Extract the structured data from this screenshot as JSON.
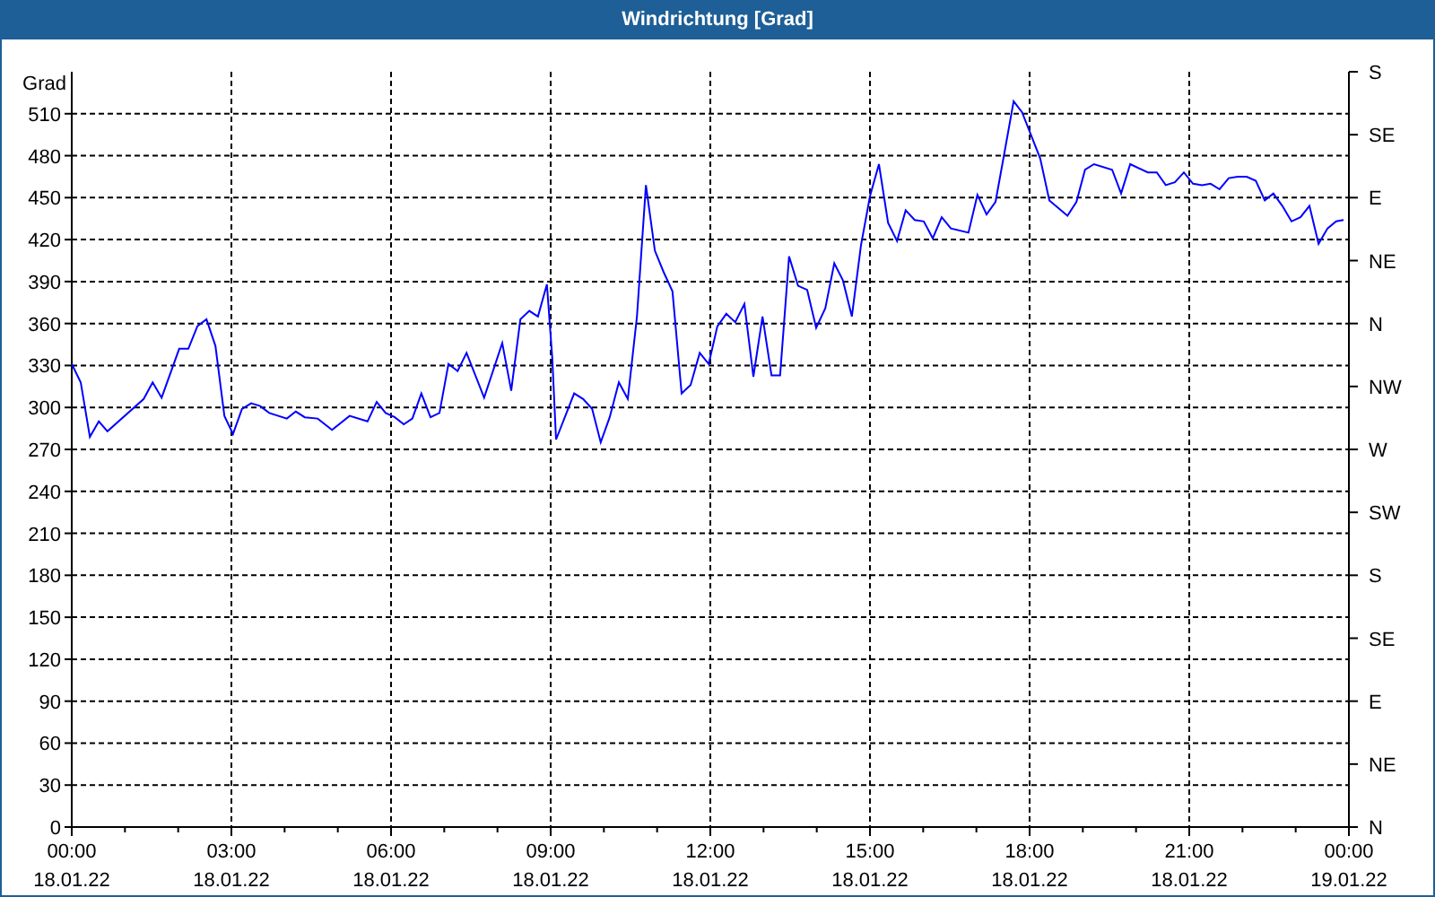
{
  "window": {
    "title": "Windrichtung [Grad]"
  },
  "chart": {
    "date_labels": [
      "18.01.22",
      "18.01.22",
      "18.01.22",
      "18.01.22",
      "18.01.22",
      "18.01.22",
      "18.01.22",
      "18.01.22",
      "19.01.22"
    ],
    "compass_labels": [
      "S",
      "SE",
      "E",
      "NE",
      "N",
      "NW",
      "W",
      "SW",
      "S",
      "SE",
      "E",
      "NE",
      "N"
    ],
    "chart_data": {
      "type": "line",
      "ylabel": "Grad",
      "xlim": [
        0,
        24
      ],
      "ylim": [
        0,
        540
      ],
      "grid": true,
      "yticks": [
        0,
        30,
        60,
        90,
        120,
        150,
        180,
        210,
        240,
        270,
        300,
        330,
        360,
        390,
        420,
        450,
        480,
        510
      ],
      "xticks": [
        {
          "value": 0,
          "label": "00:00"
        },
        {
          "value": 3,
          "label": "03:00"
        },
        {
          "value": 6,
          "label": "06:00"
        },
        {
          "value": 9,
          "label": "09:00"
        },
        {
          "value": 12,
          "label": "12:00"
        },
        {
          "value": 15,
          "label": "15:00"
        },
        {
          "value": 18,
          "label": "18:00"
        },
        {
          "value": 21,
          "label": "21:00"
        },
        {
          "value": 24,
          "label": "00:00"
        }
      ],
      "x": [
        0,
        0.17,
        0.34,
        0.51,
        0.67,
        1.35,
        1.52,
        1.69,
        2.02,
        2.19,
        2.36,
        2.53,
        2.7,
        2.87,
        3.03,
        3.2,
        3.37,
        3.54,
        3.71,
        4.04,
        4.21,
        4.38,
        4.62,
        4.89,
        5.22,
        5.56,
        5.73,
        5.9,
        6.07,
        6.24,
        6.4,
        6.57,
        6.74,
        6.91,
        7.08,
        7.25,
        7.42,
        7.75,
        8.09,
        8.26,
        8.43,
        8.6,
        8.76,
        8.93,
        9.03,
        9.1,
        9.44,
        9.61,
        9.78,
        9.94,
        10.11,
        10.28,
        10.45,
        10.62,
        10.79,
        10.96,
        11.12,
        11.29,
        11.46,
        11.63,
        11.8,
        11.97,
        12.13,
        12.3,
        12.47,
        12.64,
        12.81,
        12.98,
        13.15,
        13.31,
        13.48,
        13.65,
        13.82,
        13.99,
        14.16,
        14.33,
        14.49,
        14.66,
        14.83,
        15,
        15.17,
        15.34,
        15.51,
        15.67,
        15.84,
        16.01,
        16.18,
        16.35,
        16.52,
        16.85,
        17.02,
        17.19,
        17.36,
        17.53,
        17.7,
        17.86,
        18.2,
        18.37,
        18.71,
        18.88,
        19.04,
        19.21,
        19.55,
        19.72,
        19.89,
        20.22,
        20.39,
        20.56,
        20.73,
        20.9,
        21.07,
        21.24,
        21.4,
        21.57,
        21.74,
        21.91,
        22.08,
        22.25,
        22.42,
        22.58,
        22.75,
        22.92,
        23.09,
        23.26,
        23.43,
        23.6,
        23.76,
        23.9
      ],
      "series": [
        {
          "color": "#0000ff",
          "values": [
            331,
            318,
            279,
            290,
            283,
            306,
            318,
            307,
            342,
            342,
            358,
            363,
            344,
            294,
            281,
            299,
            303,
            301,
            296,
            292,
            297,
            293,
            292,
            284,
            294,
            290,
            304,
            296,
            293,
            288,
            292,
            310,
            293,
            296,
            331,
            326,
            339,
            307,
            346,
            312,
            363,
            369,
            365,
            388,
            335,
            277,
            310,
            306,
            299,
            275,
            293,
            318,
            306,
            365,
            459,
            412,
            397,
            383,
            310,
            316,
            339,
            331,
            358,
            367,
            361,
            374,
            322,
            365,
            323,
            323,
            408,
            387,
            384,
            357,
            371,
            403,
            391,
            365,
            416,
            451,
            474,
            432,
            419,
            441,
            434,
            433,
            421,
            436,
            428,
            425,
            452,
            438,
            447,
            483,
            519,
            511,
            478,
            448,
            437,
            447,
            470,
            474,
            470,
            453,
            474,
            468,
            468,
            459,
            461,
            468,
            460,
            459,
            460,
            456,
            464,
            465,
            465,
            462,
            448,
            453,
            444,
            433,
            436,
            444,
            417,
            428,
            433,
            434
          ]
        }
      ]
    }
  }
}
